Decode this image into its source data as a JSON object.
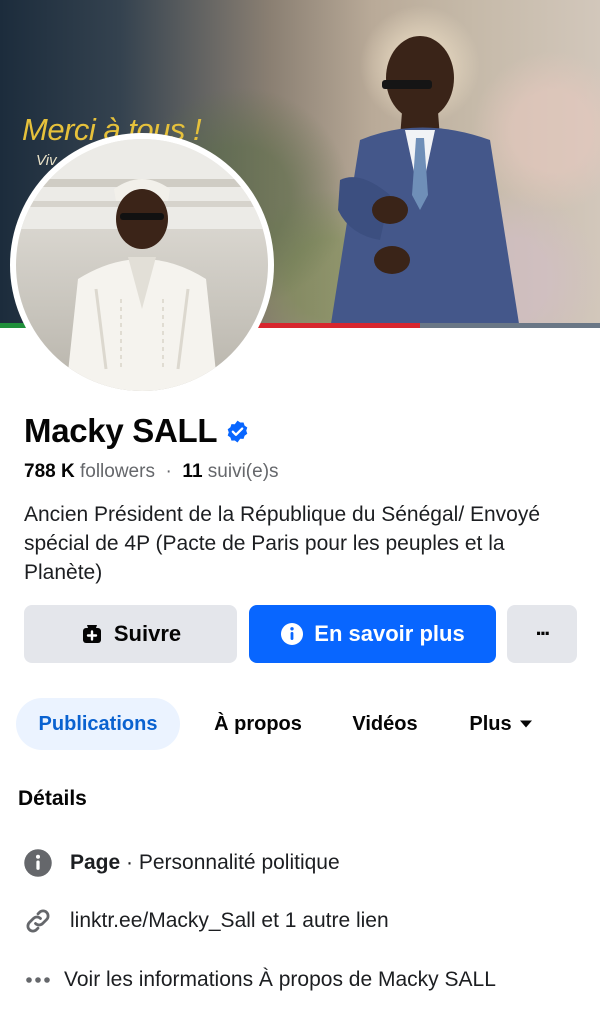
{
  "cover": {
    "headline": "Merci à tous !",
    "subline": "Viv"
  },
  "profile": {
    "name": "Macky SALL",
    "followers_count": "788 K",
    "followers_label": "followers",
    "following_count": "11",
    "following_label": "suivi(e)s",
    "bio": "Ancien Président de la République du Sénégal/ Envoyé spécial de 4P (Pacte de Paris pour les peuples et la Planète)"
  },
  "actions": {
    "follow_label": "Suivre",
    "learn_more_label": "En savoir plus",
    "more_label": "···"
  },
  "tabs": [
    {
      "label": "Publications",
      "active": true
    },
    {
      "label": "À propos",
      "active": false
    },
    {
      "label": "Vidéos",
      "active": false
    },
    {
      "label": "Plus",
      "active": false
    }
  ],
  "details": {
    "title": "Détails",
    "page_type_bold": "Page",
    "page_type_rest": " · Personnalité politique",
    "link_text": "linktr.ee/Macky_Sall et 1 autre lien",
    "about_text": "Voir les informations À propos de Macky SALL"
  },
  "colors": {
    "accent": "#0866ff",
    "verified": "#0866ff",
    "active_tab_bg": "#ebf3ff",
    "button_gray": "#e4e6eb"
  }
}
